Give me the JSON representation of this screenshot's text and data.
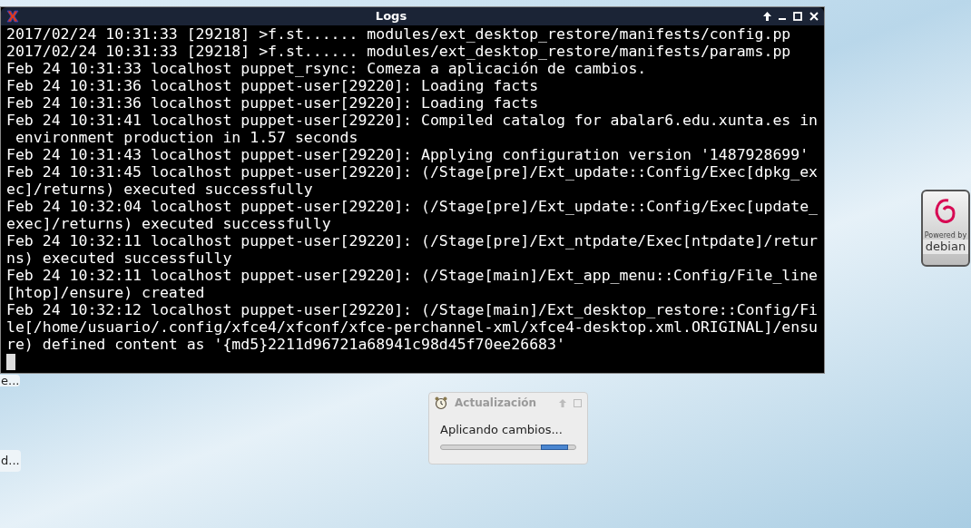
{
  "terminal_window": {
    "title": "Logs",
    "lines": [
      "2017/02/24 10:31:33 [29218] >f.st...... modules/ext_desktop_restore/manifests/config.pp",
      "2017/02/24 10:31:33 [29218] >f.st...... modules/ext_desktop_restore/manifests/params.pp",
      "Feb 24 10:31:33 localhost puppet_rsync: Comeza a aplicación de cambios.",
      "Feb 24 10:31:36 localhost puppet-user[29220]: Loading facts",
      "Feb 24 10:31:36 localhost puppet-user[29220]: Loading facts",
      "Feb 24 10:31:41 localhost puppet-user[29220]: Compiled catalog for abalar6.edu.xunta.es in",
      " environment production in 1.57 seconds",
      "Feb 24 10:31:43 localhost puppet-user[29220]: Applying configuration version '1487928699'",
      "Feb 24 10:31:45 localhost puppet-user[29220]: (/Stage[pre]/Ext_update::Config/Exec[dpkg_ex",
      "ec]/returns) executed successfully",
      "Feb 24 10:32:04 localhost puppet-user[29220]: (/Stage[pre]/Ext_update::Config/Exec[update_",
      "exec]/returns) executed successfully",
      "Feb 24 10:32:11 localhost puppet-user[29220]: (/Stage[pre]/Ext_ntpdate/Exec[ntpdate]/retur",
      "ns) executed successfully",
      "Feb 24 10:32:11 localhost puppet-user[29220]: (/Stage[main]/Ext_app_menu::Config/File_line",
      "[htop]/ensure) created",
      "Feb 24 10:32:12 localhost puppet-user[29220]: (/Stage[main]/Ext_desktop_restore::Config/Fi",
      "le[/home/usuario/.config/xfce4/xfconf/xfce-perchannel-xml/xfce4-desktop.xml.ORIGINAL]/ensu",
      "re) defined content as '{md5}2211d96721a68941c98d45f70ee26683'"
    ]
  },
  "desktop_labels": [
    "e...",
    "d..."
  ],
  "update_dialog": {
    "title": "Actualización",
    "message": "Aplicando cambios..."
  },
  "debian_badge": {
    "caption": "Powered by",
    "name": "debian"
  }
}
